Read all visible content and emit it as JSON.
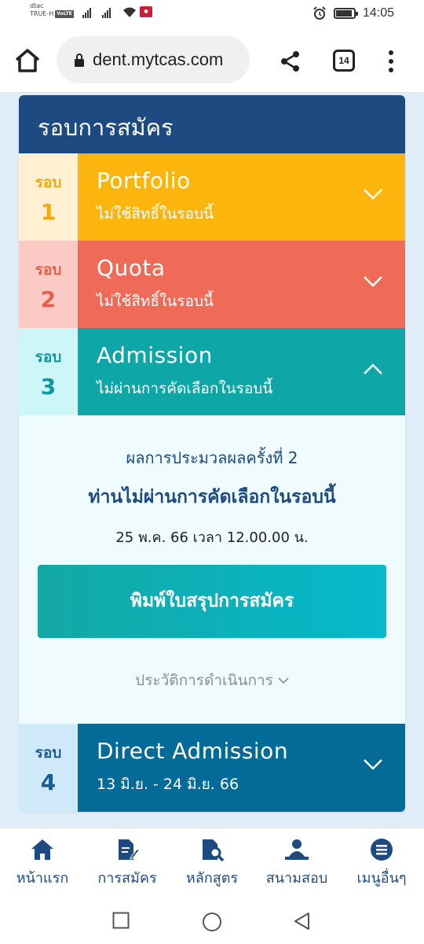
{
  "status_bar": {
    "carrier_line1": "dtac",
    "carrier_line2": "TRUE-H",
    "volte": "VoLTE",
    "time": "14:05"
  },
  "browser": {
    "url": "dent.mytcas.com",
    "tab_count": "14"
  },
  "card": {
    "title": "รอบการสมัคร",
    "rounds": [
      {
        "label": "รอบ",
        "number": "1",
        "name": "Portfolio",
        "status": "ไม่ใช้สิทธิ์ในรอบนี้",
        "expanded": false,
        "color": "#fbb50d"
      },
      {
        "label": "รอบ",
        "number": "2",
        "name": "Quota",
        "status": "ไม่ใช้สิทธิ์ในรอบนี้",
        "expanded": false,
        "color": "#ef6b57"
      },
      {
        "label": "รอบ",
        "number": "3",
        "name": "Admission",
        "status": "ไม่ผ่านการคัดเลือกในรอบนี้",
        "expanded": true,
        "color": "#0fa6a7"
      },
      {
        "label": "รอบ",
        "number": "4",
        "name": "Direct Admission",
        "status": "13 มิ.ย. - 24 มิ.ย. 66",
        "expanded": false,
        "color": "#046a97"
      }
    ],
    "detail": {
      "result_title": "ผลการประมวลผลครั้งที่ 2",
      "result_main": "ท่านไม่ผ่านการคัดเลือกในรอบนี้",
      "result_date": "25 พ.ค. 66 เวลา 12.00.00 น.",
      "print_button": "พิมพ์ใบสรุปการสมัคร",
      "history_link": "ประวัติการดำเนินการ"
    }
  },
  "bottom_nav": [
    {
      "label": "หน้าแรก",
      "icon": "home-icon"
    },
    {
      "label": "การสมัคร",
      "icon": "application-icon"
    },
    {
      "label": "หลักสูตร",
      "icon": "course-search-icon"
    },
    {
      "label": "สนามสอบ",
      "icon": "exam-venue-icon"
    },
    {
      "label": "เมนูอื่นๆ",
      "icon": "more-menu-icon"
    }
  ]
}
